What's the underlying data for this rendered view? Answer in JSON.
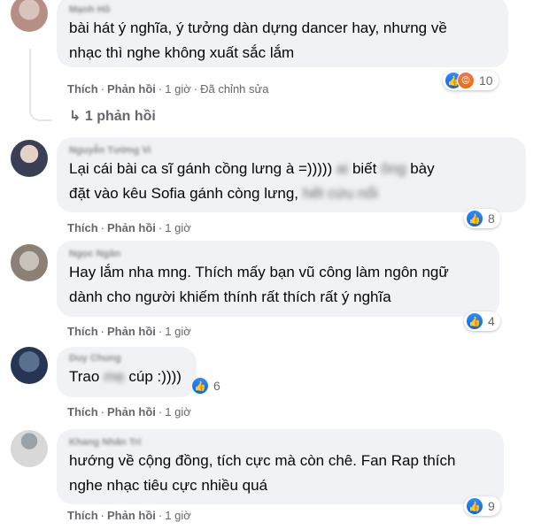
{
  "comments": [
    {
      "author": "Mạnh Hồ",
      "line1": "bài hát ý nghĩa, ý tưởng dàn dựng dancer hay, nhưng về",
      "line2": "nhạc thì nghe không xuất sắc lắm",
      "like": "Thích",
      "reply": "Phản hồi",
      "time": "1 giờ",
      "edited": "Đã chỉnh sửa",
      "reaction_count": "10",
      "reactions": [
        "like-icon",
        "angry-icon"
      ],
      "replies_label": "1 phản hồi"
    },
    {
      "author": "Nguyễn Tường Vi",
      "line1_a": "Lại cái bài ca sĩ gánh cồng lưng à =)))))",
      "line1_blur1": "ai",
      "line1_b": "biết",
      "line1_blur2": "ông",
      "line1_c": "bày",
      "line2_a": "đặt vào kêu Sofia gánh còng lưng,",
      "line2_blur": "hết cứu nổi",
      "like": "Thích",
      "reply": "Phản hồi",
      "time": "1 giờ",
      "reaction_count": "8"
    },
    {
      "author": "Ngọc Ngân",
      "line1": "Hay lắm nha mng. Thích mấy bạn vũ công làm ngôn ngữ",
      "line2": "dành cho người khiếm thính rất thích rất ý nghĩa",
      "like": "Thích",
      "reply": "Phản hồi",
      "time": "1 giờ",
      "reaction_count": "4"
    },
    {
      "author": "Duy Chung",
      "text_a": "Trao",
      "text_blur": "mẹ",
      "text_b": "cúp :))))",
      "like": "Thích",
      "reply": "Phản hồi",
      "time": "1 giờ",
      "reaction_count": "6"
    },
    {
      "author": "Khang Nhân Trí",
      "line1": "hướng về cộng đồng, tích cực mà còn chê. Fan Rap thích",
      "line2": "nghe nhạc tiêu cực nhiều quá",
      "like": "Thích",
      "reply": "Phản hồi",
      "time": "1 giờ",
      "reaction_count": "9"
    }
  ],
  "colors": {
    "like_blue": "#1877f2",
    "bubble": "#f0f2f5",
    "meta": "#65676b"
  }
}
